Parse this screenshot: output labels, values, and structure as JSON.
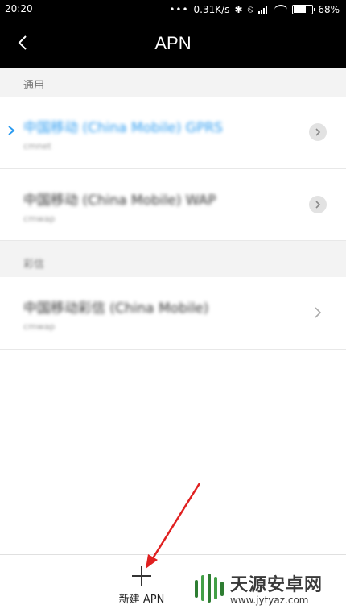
{
  "status_bar": {
    "time": "20:20",
    "speed": "0.31K/s",
    "battery": "68%",
    "battery_level": 0.68
  },
  "app_bar": {
    "title": "APN"
  },
  "sections": [
    {
      "label": "通用",
      "rows": [
        {
          "name": "中国移动 (China Mobile) GPRS",
          "sub": "cmnet",
          "selected": true
        },
        {
          "name": "中国移动 (China Mobile) WAP",
          "sub": "cmwap",
          "selected": false
        }
      ]
    },
    {
      "label": "彩信",
      "rows": [
        {
          "name": "中国移动彩信 (China Mobile)",
          "sub": "cmwap",
          "selected": false
        }
      ]
    }
  ],
  "bottom_bar": {
    "add_label": "新建 APN"
  },
  "watermark": {
    "name": "天源安卓网",
    "url": "www.jytyaz.com"
  },
  "colors": {
    "selected_text": "#2b9bf0",
    "annotation_arrow": "#e02020"
  }
}
